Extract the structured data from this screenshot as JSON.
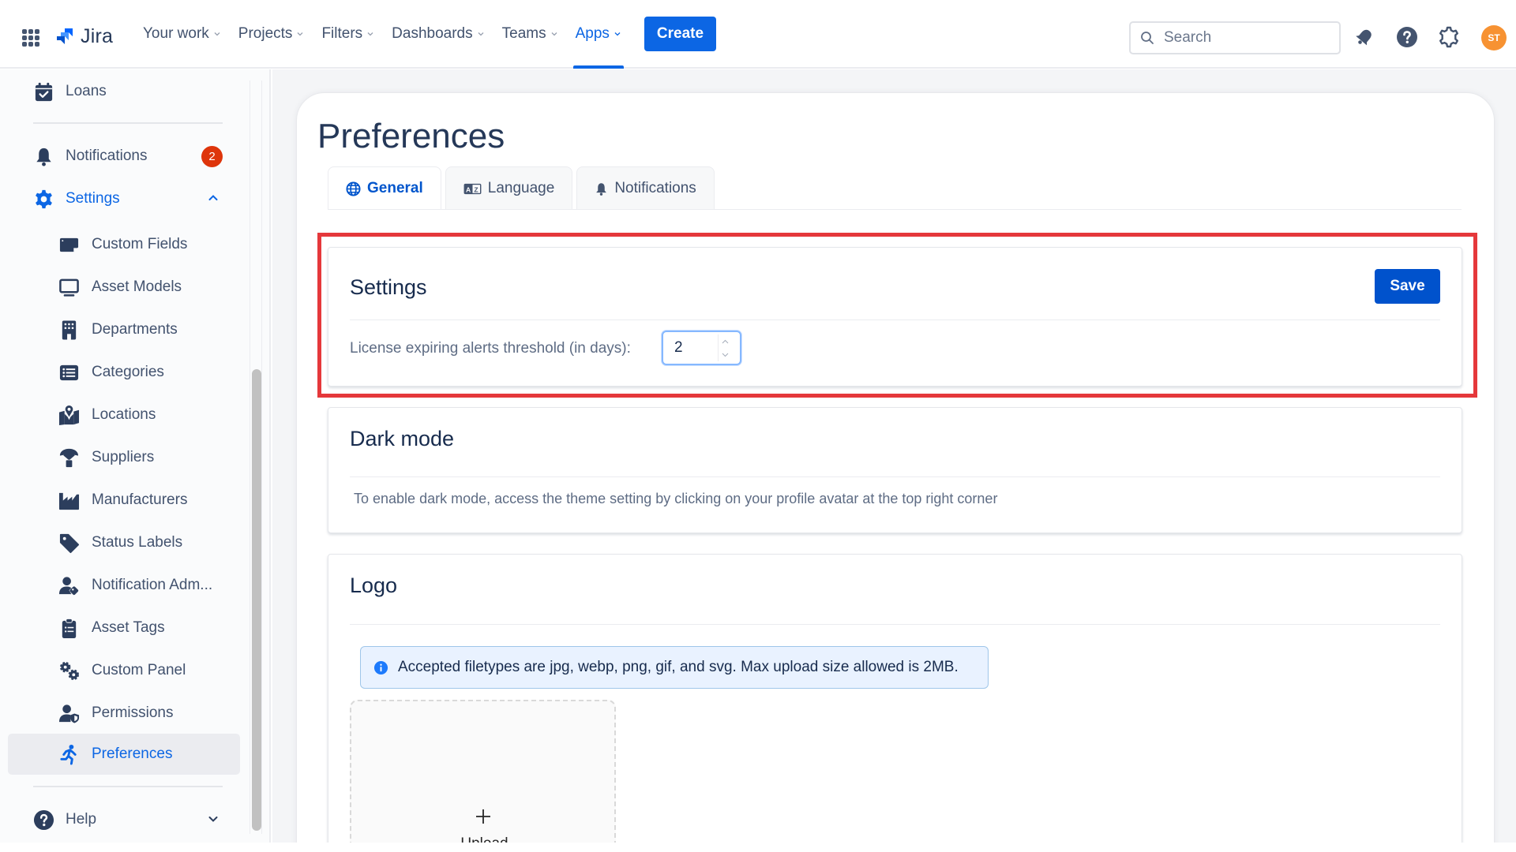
{
  "header": {
    "app_name": "Jira",
    "nav": [
      {
        "label": "Your work",
        "active": false
      },
      {
        "label": "Projects",
        "active": false
      },
      {
        "label": "Filters",
        "active": false
      },
      {
        "label": "Dashboards",
        "active": false
      },
      {
        "label": "Teams",
        "active": false
      },
      {
        "label": "Apps",
        "active": true
      }
    ],
    "create_label": "Create",
    "search_placeholder": "Search",
    "icons": [
      "notifications-icon",
      "help-icon",
      "settings-icon"
    ],
    "avatar_initials": "ST",
    "avatar_color": "#f79232",
    "accent_color": "#0c66e4"
  },
  "sidebar": {
    "top_items": [
      {
        "label": "Loans",
        "icon": "calendar-check-icon"
      },
      {
        "label": "Notifications",
        "icon": "bell-icon",
        "badge": "2"
      },
      {
        "label": "Settings",
        "icon": "gear-icon",
        "expanded": true
      }
    ],
    "settings_children": [
      {
        "label": "Custom Fields",
        "icon": "custom-fields-icon"
      },
      {
        "label": "Asset Models",
        "icon": "monitor-icon"
      },
      {
        "label": "Departments",
        "icon": "building-icon"
      },
      {
        "label": "Categories",
        "icon": "list-icon"
      },
      {
        "label": "Locations",
        "icon": "map-pin-icon"
      },
      {
        "label": "Suppliers",
        "icon": "parachute-box-icon"
      },
      {
        "label": "Manufacturers",
        "icon": "industry-icon"
      },
      {
        "label": "Status Labels",
        "icon": "tag-icon"
      },
      {
        "label": "Notification Adm...",
        "icon": "user-tag-icon"
      },
      {
        "label": "Asset Tags",
        "icon": "clipboard-list-icon"
      },
      {
        "label": "Custom Panel",
        "icon": "gears-icon"
      },
      {
        "label": "Permissions",
        "icon": "user-shield-icon"
      },
      {
        "label": "Preferences",
        "icon": "person-running-icon",
        "selected": true
      }
    ],
    "help_label": "Help",
    "badge_color": "#de350b"
  },
  "main": {
    "title": "Preferences",
    "tabs": [
      {
        "label": "General",
        "icon": "globe-icon",
        "active": true
      },
      {
        "label": "Language",
        "icon": "language-icon",
        "active": false
      },
      {
        "label": "Notifications",
        "icon": "bell-icon",
        "active": false
      }
    ],
    "settings_panel": {
      "title": "Settings",
      "save_label": "Save",
      "field_label": "License expiring alerts threshold (in days):",
      "field_value": "2"
    },
    "dark_mode_panel": {
      "title": "Dark mode",
      "text": "To enable dark mode, access the theme setting by clicking on your profile avatar at the top right corner"
    },
    "logo_panel": {
      "title": "Logo",
      "info": "Accepted filetypes are jpg, webp, png, gif, and svg. Max upload size allowed is 2MB.",
      "upload_label": "Upload"
    },
    "highlight_color": "#e5383b"
  }
}
